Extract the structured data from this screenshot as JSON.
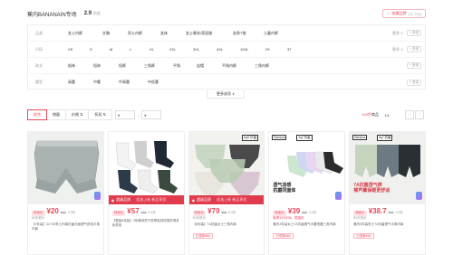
{
  "store": {
    "title": "蕉内BANANAIN专场",
    "score": "2.9",
    "score_sub": "折起",
    "fav_label": "收藏品牌",
    "fav_count": "(11,728)"
  },
  "filters": [
    {
      "label": "品类",
      "options": [
        "女士内裤",
        "文胸",
        "男士内裤",
        "女袜",
        "女士睡衣/家居服",
        "女款T恤",
        "儿童内裤"
      ],
      "more": "更多 ∨",
      "multi": "+ 多选"
    },
    {
      "label": "尺码",
      "options": [
        "XS",
        "S",
        "M",
        "L",
        "XL",
        "2XL",
        "3XL",
        "4XL",
        "10XL",
        "29",
        "37"
      ],
      "more": "更多 ∨",
      "multi": "+ 多选"
    },
    {
      "label": "款式",
      "options": [
        "船袜",
        "短袜",
        "短裤",
        "三角裤",
        "平角",
        "连帽",
        "平角内裤",
        "三角内裤"
      ],
      "more": "",
      "multi": "+ 多选"
    },
    {
      "label": "腰型",
      "options": [
        "高腰",
        "中腰",
        "中高腰",
        "中低腰"
      ],
      "more": "",
      "multi": "+ 多选"
    }
  ],
  "more_options": "更多选项 ∨",
  "sortbar": {
    "tabs": [
      "综合",
      "销量",
      "价格 ⇅",
      "折扣 ⇅"
    ],
    "price_from": "¥",
    "price_to": "¥",
    "dash": "-",
    "result_count": "200件",
    "result_unit": "商品",
    "pager": "1/1",
    "prev": "‹",
    "next": "›"
  },
  "products": [
    {
      "tag": "特卖价",
      "price": "¥20",
      "old": "¥99",
      "disc": "2.0折",
      "sub": "80天低价",
      "desc": "【2件装】3174S男士内裤抗菌无痕透气舒适平角内裤",
      "coupon": "",
      "banner": null,
      "sub_red": false
    },
    {
      "tag": "特卖价",
      "price": "¥57",
      "old": "¥89",
      "disc": "6.3折",
      "sub": "",
      "desc": "【整装6双装】3系蕉袜男子低帮船袜防臭防滑多色男袜",
      "coupon": "",
      "banner": {
        "b1": "超级品质",
        "b2": "优选上新 新品享优"
      },
      "sub_red": false
    },
    {
      "tag": "特卖价",
      "price": "¥79",
      "old": "¥99",
      "disc": "8.0折",
      "sub": "80天低价",
      "desc": "【5件装】7A抗菌女士三角内裤",
      "coupon": "已领券¥80",
      "banner": {
        "b1": "超级品质",
        "b2": "优选上新 新品享优"
      },
      "sub_red": false
    },
    {
      "tag": "特卖价",
      "price": "¥39",
      "old": "¥92",
      "disc": "4.2折",
      "sub": "新享10元¥36、限量抢",
      "desc": "蕉内3件装女士7A抗菌透气中腰低腰三角内裤",
      "coupon": "已领券¥80",
      "banner": null,
      "sub_red": true
    },
    {
      "tag": "特卖价",
      "price": "¥38.7",
      "old": "¥99",
      "disc": "3.9折",
      "sub": "80天低价",
      "desc": "蕉内3件装男士7A抗菌透气平角内裤",
      "coupon": "已领券¥80",
      "banner": null,
      "sub_red": false
    }
  ],
  "promo": {
    "p3_badge": "AgS 抗菌",
    "p4_brand": "Banana",
    "p4_ag": "Ag⁺抗菌",
    "p4_text": "透气凉感\n抗菌同面体",
    "p5_brand": "Banana",
    "p5_ag": "Ag⁺抗菌",
    "p5_text": "7A抗菌透气棉\n裸芦翼保暖更舒适"
  },
  "colors": {
    "accent": "#e8495c",
    "banner": "#e03c4d"
  }
}
